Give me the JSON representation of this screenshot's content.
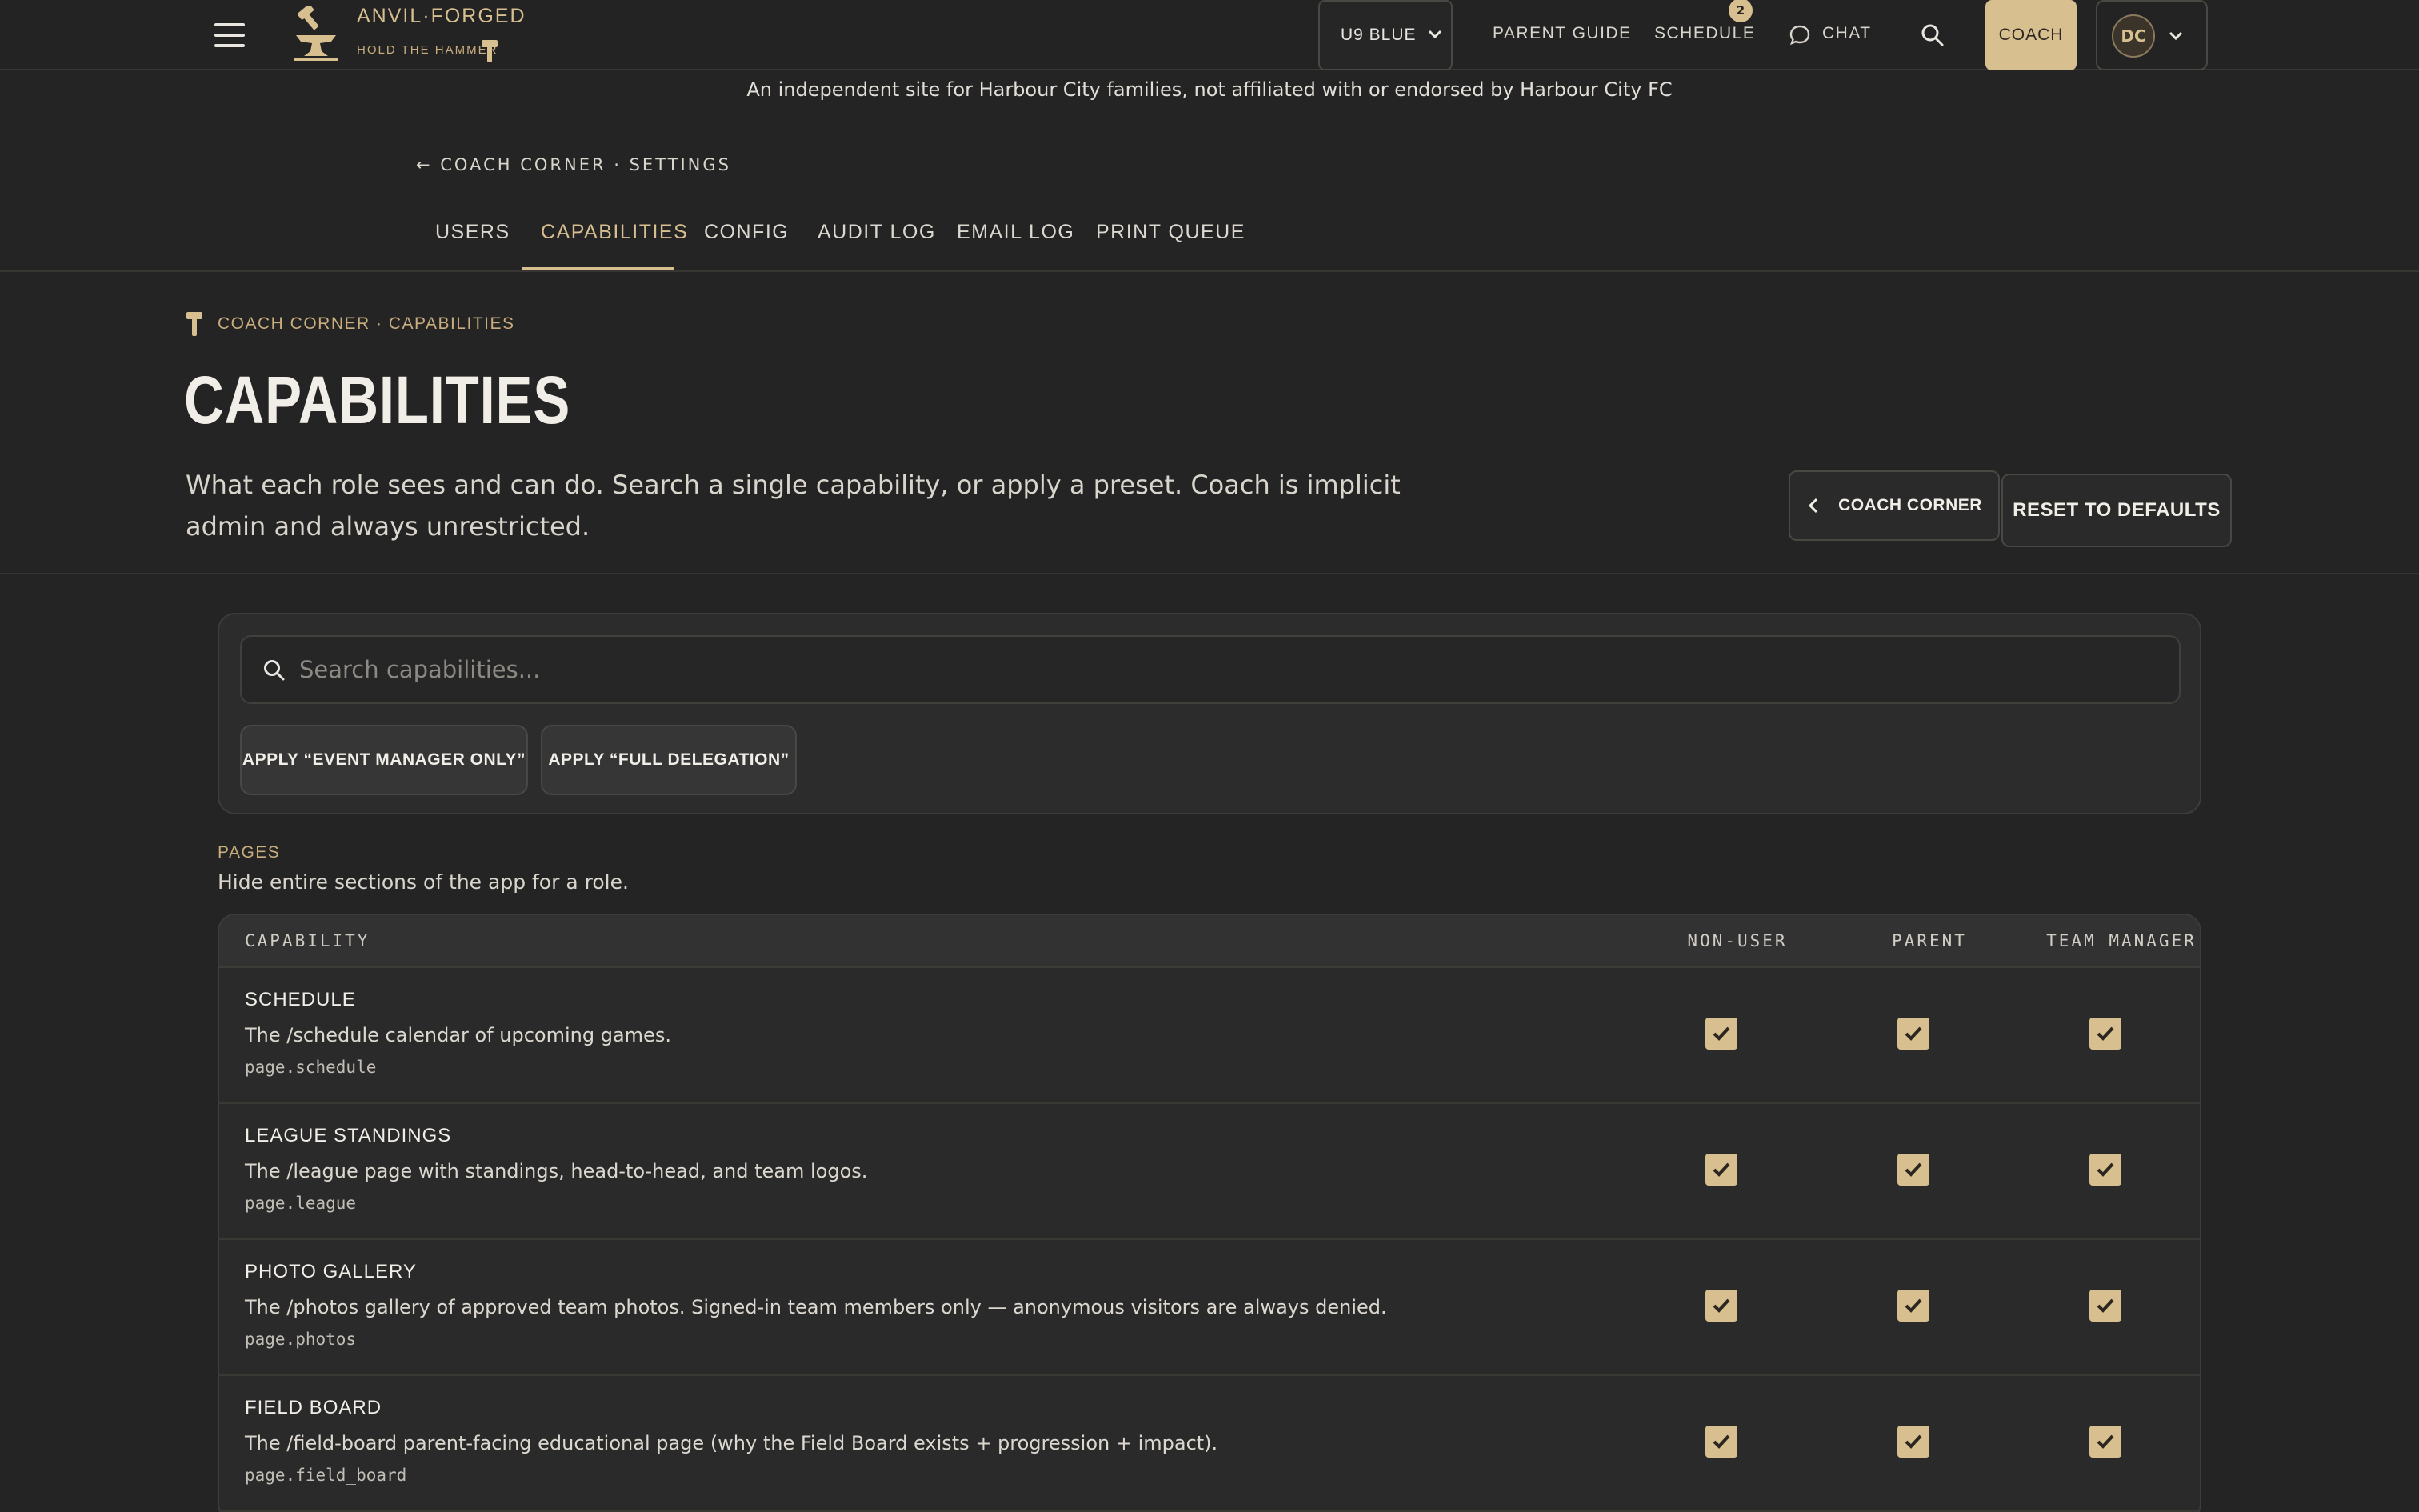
{
  "topbar": {
    "brand_name": "ANVIL·FORGED",
    "brand_tagline": "HOLD THE HAMMER",
    "team_select": "U9 BLUE",
    "nav": {
      "parent_guide": "PARENT GUIDE",
      "schedule": "SCHEDULE",
      "schedule_badge": "2",
      "chat": "CHAT"
    },
    "coach_label": "COACH",
    "avatar_initials": "DC"
  },
  "disclaimer": "An independent site for Harbour City families, not affiliated with or endorsed by Harbour City FC",
  "settings": {
    "back_link": "← COACH CORNER · SETTINGS",
    "tabs": [
      "USERS",
      "CAPABILITIES",
      "CONFIG",
      "AUDIT LOG",
      "EMAIL LOG",
      "PRINT QUEUE"
    ],
    "active_tab": "CAPABILITIES"
  },
  "header": {
    "breadcrumb": "COACH CORNER · CAPABILITIES",
    "title": "CAPABILITIES",
    "description": "What each role sees and can do. Search a single capability, or apply a preset. Coach is implicit admin and always unrestricted.",
    "back_button": "COACH CORNER",
    "reset_button": "RESET TO DEFAULTS"
  },
  "search": {
    "placeholder": "Search capabilities...",
    "value": "",
    "preset_buttons": [
      "APPLY “EVENT MANAGER ONLY”",
      "APPLY “FULL DELEGATION”"
    ]
  },
  "section": {
    "label": "PAGES",
    "description": "Hide entire sections of the app for a role.",
    "columns": [
      "CAPABILITY",
      "NON-USER",
      "PARENT",
      "TEAM MANAGER"
    ],
    "rows": [
      {
        "name": "SCHEDULE",
        "description": "The /schedule calendar of upcoming games.",
        "key": "page.schedule",
        "non_user": true,
        "parent": true,
        "team_manager": true
      },
      {
        "name": "LEAGUE STANDINGS",
        "description": "The /league page with standings, head-to-head, and team logos.",
        "key": "page.league",
        "non_user": true,
        "parent": true,
        "team_manager": true
      },
      {
        "name": "PHOTO GALLERY",
        "description": "The /photos gallery of approved team photos. Signed-in team members only — anonymous visitors are always denied.",
        "key": "page.photos",
        "non_user": true,
        "parent": true,
        "team_manager": true
      },
      {
        "name": "FIELD BOARD",
        "description": "The /field-board parent-facing educational page (why the Field Board exists + progression + impact).",
        "key": "page.field_board",
        "non_user": true,
        "parent": true,
        "team_manager": true
      }
    ]
  },
  "colors": {
    "accent": "#d8bf90",
    "background": "#242424",
    "panel": "#2c2c2c"
  }
}
